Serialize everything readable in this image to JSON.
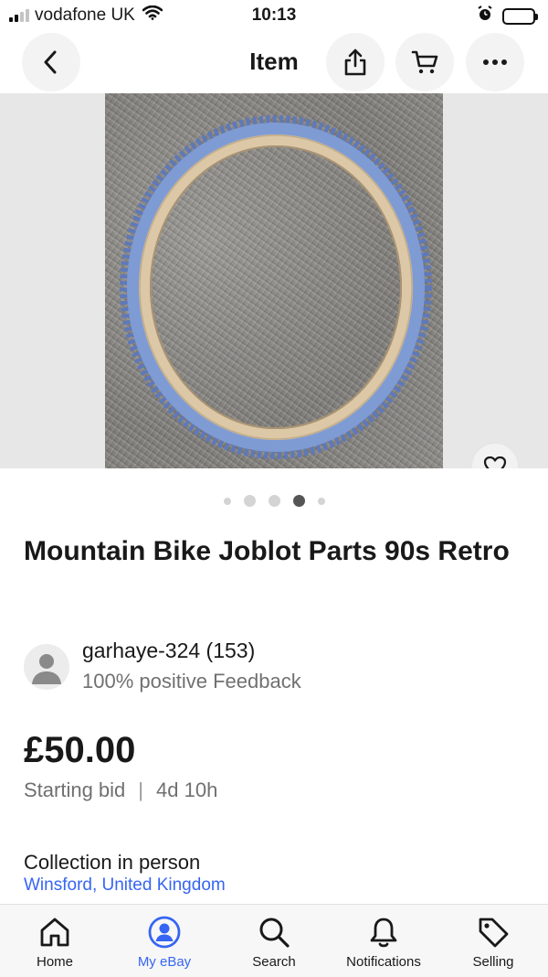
{
  "status_bar": {
    "carrier": "vodafone UK",
    "time": "10:13"
  },
  "header": {
    "title": "Item",
    "icons": [
      "back-arrow",
      "share",
      "cart",
      "more-dots"
    ]
  },
  "gallery": {
    "image_count": 5,
    "active_index": 3
  },
  "listing": {
    "title": "Mountain Bike Joblot Parts 90s Retro",
    "seller": {
      "name": "garhaye-324 (153)",
      "feedback": "100% positive Feedback"
    },
    "price": "£50.00",
    "bid_type": "Starting bid",
    "separator": "|",
    "time_left": "4d 10h",
    "delivery": "Collection in person",
    "location": "Winsford, United Kingdom"
  },
  "tab_bar": {
    "items": [
      {
        "label": "Home",
        "icon": "home-icon"
      },
      {
        "label": "My eBay",
        "icon": "user-icon"
      },
      {
        "label": "Search",
        "icon": "search-icon"
      },
      {
        "label": "Notifications",
        "icon": "bell-icon"
      },
      {
        "label": "Selling",
        "icon": "tag-icon"
      }
    ],
    "active_index": 1
  },
  "colors": {
    "accent": "#3665f3",
    "text": "#191919",
    "muted": "#707070",
    "tyre": "#7f9bd4",
    "rim": "#dcc8a6"
  }
}
